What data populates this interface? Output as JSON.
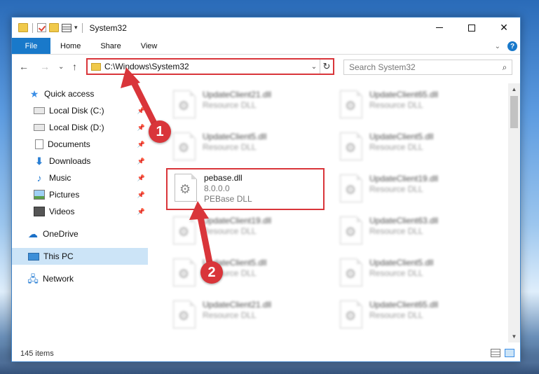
{
  "window": {
    "title": "System32",
    "qat_arrow": "▾"
  },
  "ribbon": {
    "tabs": [
      "File",
      "Home",
      "Share",
      "View"
    ],
    "help": "?",
    "expand": "⌄"
  },
  "nav": {
    "back": "←",
    "forward": "→",
    "recent": "⌄",
    "up": "↑",
    "address": "C:\\Windows\\System32",
    "address_dropdown": "⌄",
    "refresh": "↻",
    "search_placeholder": "Search System32",
    "search_icon": "⌕"
  },
  "sidebar": {
    "items": [
      {
        "label": "Quick access",
        "icon": "star-icon",
        "pinned": false
      },
      {
        "label": "Local Disk (C:)",
        "icon": "drive-icon",
        "pinned": true
      },
      {
        "label": "Local Disk (D:)",
        "icon": "drive-icon",
        "pinned": true
      },
      {
        "label": "Documents",
        "icon": "documents-icon",
        "pinned": true
      },
      {
        "label": "Downloads",
        "icon": "downloads-icon",
        "pinned": true
      },
      {
        "label": "Music",
        "icon": "music-icon",
        "pinned": true
      },
      {
        "label": "Pictures",
        "icon": "pictures-icon",
        "pinned": true
      },
      {
        "label": "Videos",
        "icon": "videos-icon",
        "pinned": true
      },
      {
        "label": "OneDrive",
        "icon": "onedrive-icon",
        "pinned": false
      },
      {
        "label": "This PC",
        "icon": "this-pc-icon",
        "pinned": false,
        "selected": true
      },
      {
        "label": "Network",
        "icon": "network-icon",
        "pinned": false
      }
    ]
  },
  "files": {
    "left": [
      {
        "name": "UpdateClient21.dll",
        "meta": "Resource DLL"
      },
      {
        "name": "UpdateClient5.dll",
        "meta": "Resource DLL"
      },
      {
        "name": "pebase.dll",
        "version": "8.0.0.0",
        "meta": "PEBase DLL",
        "highlight": true
      },
      {
        "name": "UpdateClient19.dll",
        "meta": "Resource DLL"
      },
      {
        "name": "UpdateClient5.dll",
        "meta": "Resource DLL"
      },
      {
        "name": "UpdateClient21.dll",
        "meta": "Resource DLL"
      }
    ],
    "right": [
      {
        "name": "UpdateClient65.dll",
        "meta": "Resource DLL"
      },
      {
        "name": "UpdateClient5.dll",
        "meta": "Resource DLL"
      },
      {
        "name": "UpdateClient19.dll",
        "meta": "Resource DLL"
      },
      {
        "name": "UpdateClient63.dll",
        "meta": "Resource DLL"
      },
      {
        "name": "UpdateClient5.dll",
        "meta": "Resource DLL"
      },
      {
        "name": "UpdateClient65.dll",
        "meta": "Resource DLL"
      }
    ]
  },
  "status": {
    "item_count": "145 items"
  },
  "annotations": {
    "step1": "1",
    "step2": "2",
    "color": "#d9353a"
  },
  "colors": {
    "accent": "#1979ca",
    "selection": "#cce4f7",
    "annotation_red": "#d9353a"
  }
}
